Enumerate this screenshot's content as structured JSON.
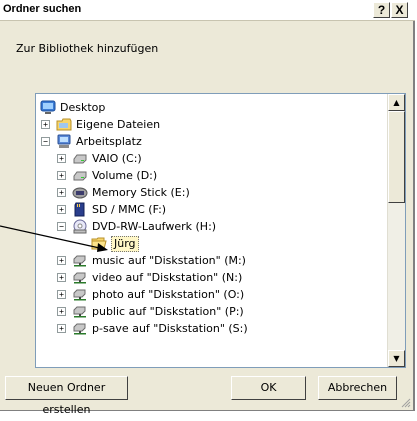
{
  "window": {
    "title": "Ordner suchen",
    "help_button": "?",
    "close_button": "X"
  },
  "prompt": "Zur Bibliothek hinzufügen",
  "tree": {
    "items": [
      {
        "label": "Desktop",
        "icon": "desktop-icon",
        "level": 0,
        "expander": ""
      },
      {
        "label": "Eigene Dateien",
        "icon": "folder-icon",
        "level": 1,
        "expander": "+"
      },
      {
        "label": "Arbeitsplatz",
        "icon": "computer-icon",
        "level": 1,
        "expander": "−"
      },
      {
        "label": "VAIO (C:)",
        "icon": "hard-drive-icon",
        "level": 2,
        "expander": "+"
      },
      {
        "label": "Volume (D:)",
        "icon": "hard-drive-icon",
        "level": 2,
        "expander": "+"
      },
      {
        "label": "Memory Stick (E:)",
        "icon": "memory-stick-icon",
        "level": 2,
        "expander": "+"
      },
      {
        "label": "SD / MMC (F:)",
        "icon": "sd-card-icon",
        "level": 2,
        "expander": "+"
      },
      {
        "label": "DVD-RW-Laufwerk (H:)",
        "icon": "dvd-drive-icon",
        "level": 2,
        "expander": "−"
      },
      {
        "label": "Jürg",
        "icon": "open-folder-icon",
        "level": 3,
        "expander": "",
        "selected": true
      },
      {
        "label": "music auf \"Diskstation\" (M:)",
        "icon": "network-drive-icon",
        "level": 2,
        "expander": "+"
      },
      {
        "label": "video auf \"Diskstation\" (N:)",
        "icon": "network-drive-icon",
        "level": 2,
        "expander": "+"
      },
      {
        "label": "photo auf \"Diskstation\" (O:)",
        "icon": "network-drive-icon",
        "level": 2,
        "expander": "+"
      },
      {
        "label": "public auf \"Diskstation\" (P:)",
        "icon": "network-drive-icon",
        "level": 2,
        "expander": "+"
      },
      {
        "label": "p-save auf \"Diskstation\" (S:)",
        "icon": "network-drive-icon",
        "level": 2,
        "expander": "+"
      }
    ]
  },
  "buttons": {
    "new_folder": "Neuen Ordner erstellen",
    "ok": "OK",
    "cancel": "Abbrechen"
  },
  "colors": {
    "dialog_bg": "#ece9d8",
    "selection_bg": "#fff7c7",
    "tree_border": "#7f9db9"
  }
}
